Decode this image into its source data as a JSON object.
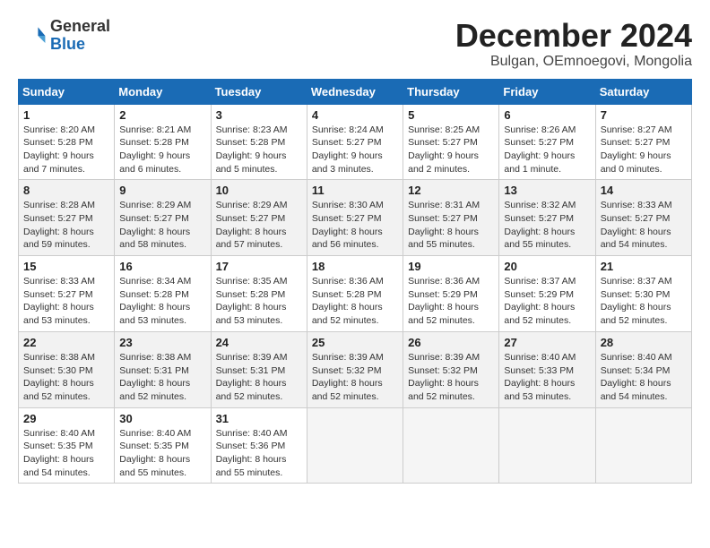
{
  "header": {
    "logo_general": "General",
    "logo_blue": "Blue",
    "month_title": "December 2024",
    "location": "Bulgan, OEmnoegovi, Mongolia"
  },
  "calendar": {
    "days_of_week": [
      "Sunday",
      "Monday",
      "Tuesday",
      "Wednesday",
      "Thursday",
      "Friday",
      "Saturday"
    ],
    "weeks": [
      [
        {
          "day": "",
          "info": ""
        },
        {
          "day": "2",
          "info": "Sunrise: 8:21 AM\nSunset: 5:28 PM\nDaylight: 9 hours and 6 minutes."
        },
        {
          "day": "3",
          "info": "Sunrise: 8:23 AM\nSunset: 5:28 PM\nDaylight: 9 hours and 5 minutes."
        },
        {
          "day": "4",
          "info": "Sunrise: 8:24 AM\nSunset: 5:27 PM\nDaylight: 9 hours and 3 minutes."
        },
        {
          "day": "5",
          "info": "Sunrise: 8:25 AM\nSunset: 5:27 PM\nDaylight: 9 hours and 2 minutes."
        },
        {
          "day": "6",
          "info": "Sunrise: 8:26 AM\nSunset: 5:27 PM\nDaylight: 9 hours and 1 minute."
        },
        {
          "day": "7",
          "info": "Sunrise: 8:27 AM\nSunset: 5:27 PM\nDaylight: 9 hours and 0 minutes."
        }
      ],
      [
        {
          "day": "1",
          "info": "Sunrise: 8:20 AM\nSunset: 5:28 PM\nDaylight: 9 hours and 7 minutes."
        },
        {
          "day": "9",
          "info": "Sunrise: 8:29 AM\nSunset: 5:27 PM\nDaylight: 8 hours and 58 minutes."
        },
        {
          "day": "10",
          "info": "Sunrise: 8:29 AM\nSunset: 5:27 PM\nDaylight: 8 hours and 57 minutes."
        },
        {
          "day": "11",
          "info": "Sunrise: 8:30 AM\nSunset: 5:27 PM\nDaylight: 8 hours and 56 minutes."
        },
        {
          "day": "12",
          "info": "Sunrise: 8:31 AM\nSunset: 5:27 PM\nDaylight: 8 hours and 55 minutes."
        },
        {
          "day": "13",
          "info": "Sunrise: 8:32 AM\nSunset: 5:27 PM\nDaylight: 8 hours and 55 minutes."
        },
        {
          "day": "14",
          "info": "Sunrise: 8:33 AM\nSunset: 5:27 PM\nDaylight: 8 hours and 54 minutes."
        }
      ],
      [
        {
          "day": "8",
          "info": "Sunrise: 8:28 AM\nSunset: 5:27 PM\nDaylight: 8 hours and 59 minutes."
        },
        {
          "day": "16",
          "info": "Sunrise: 8:34 AM\nSunset: 5:28 PM\nDaylight: 8 hours and 53 minutes."
        },
        {
          "day": "17",
          "info": "Sunrise: 8:35 AM\nSunset: 5:28 PM\nDaylight: 8 hours and 53 minutes."
        },
        {
          "day": "18",
          "info": "Sunrise: 8:36 AM\nSunset: 5:28 PM\nDaylight: 8 hours and 52 minutes."
        },
        {
          "day": "19",
          "info": "Sunrise: 8:36 AM\nSunset: 5:29 PM\nDaylight: 8 hours and 52 minutes."
        },
        {
          "day": "20",
          "info": "Sunrise: 8:37 AM\nSunset: 5:29 PM\nDaylight: 8 hours and 52 minutes."
        },
        {
          "day": "21",
          "info": "Sunrise: 8:37 AM\nSunset: 5:30 PM\nDaylight: 8 hours and 52 minutes."
        }
      ],
      [
        {
          "day": "15",
          "info": "Sunrise: 8:33 AM\nSunset: 5:27 PM\nDaylight: 8 hours and 53 minutes."
        },
        {
          "day": "23",
          "info": "Sunrise: 8:38 AM\nSunset: 5:31 PM\nDaylight: 8 hours and 52 minutes."
        },
        {
          "day": "24",
          "info": "Sunrise: 8:39 AM\nSunset: 5:31 PM\nDaylight: 8 hours and 52 minutes."
        },
        {
          "day": "25",
          "info": "Sunrise: 8:39 AM\nSunset: 5:32 PM\nDaylight: 8 hours and 52 minutes."
        },
        {
          "day": "26",
          "info": "Sunrise: 8:39 AM\nSunset: 5:32 PM\nDaylight: 8 hours and 52 minutes."
        },
        {
          "day": "27",
          "info": "Sunrise: 8:40 AM\nSunset: 5:33 PM\nDaylight: 8 hours and 53 minutes."
        },
        {
          "day": "28",
          "info": "Sunrise: 8:40 AM\nSunset: 5:34 PM\nDaylight: 8 hours and 54 minutes."
        }
      ],
      [
        {
          "day": "22",
          "info": "Sunrise: 8:38 AM\nSunset: 5:30 PM\nDaylight: 8 hours and 52 minutes."
        },
        {
          "day": "30",
          "info": "Sunrise: 8:40 AM\nSunset: 5:35 PM\nDaylight: 8 hours and 55 minutes."
        },
        {
          "day": "31",
          "info": "Sunrise: 8:40 AM\nSunset: 5:36 PM\nDaylight: 8 hours and 55 minutes."
        },
        {
          "day": "",
          "info": ""
        },
        {
          "day": "",
          "info": ""
        },
        {
          "day": "",
          "info": ""
        },
        {
          "day": "",
          "info": ""
        }
      ],
      [
        {
          "day": "29",
          "info": "Sunrise: 8:40 AM\nSunset: 5:35 PM\nDaylight: 8 hours and 54 minutes."
        },
        {
          "day": "",
          "info": ""
        },
        {
          "day": "",
          "info": ""
        },
        {
          "day": "",
          "info": ""
        },
        {
          "day": "",
          "info": ""
        },
        {
          "day": "",
          "info": ""
        },
        {
          "day": "",
          "info": ""
        }
      ]
    ]
  }
}
